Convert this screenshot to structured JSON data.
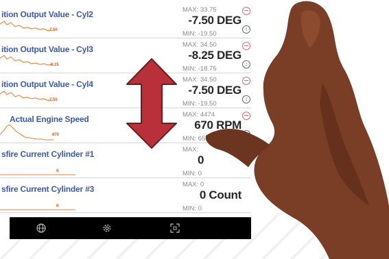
{
  "pids": [
    {
      "name": "ition Output Value - Cyl2",
      "max": "MAX: 33.75",
      "value": "-7.50 DEG",
      "min": "MIN: -19.50",
      "spark_label": "-7.50"
    },
    {
      "name": "ition Output Value - Cyl3",
      "max": "MAX: 34.50",
      "value": "-8.25 DEG",
      "min": "MIN: -18.75",
      "spark_label": "-8.25"
    },
    {
      "name": "ition Output Value - Cyl4",
      "max": "MAX: 34.50",
      "value": "-7.50 DEG",
      "min": "MIN: -19.50",
      "spark_label": "-7.50"
    },
    {
      "name": "Actual Engine Speed",
      "max": "MAX: 4474",
      "value": "670 RPM",
      "min": "MIN: 651",
      "spark_label": "670"
    },
    {
      "name": "sfire Current Cylinder #1",
      "max": "MAX:",
      "value": "0",
      "min": "MIN: 0",
      "spark_label": "0"
    },
    {
      "name": "sfire Current Cylinder #3",
      "max": "MAX: 0",
      "value": "0 Count",
      "min": "MIN: 0",
      "spark_label": "0"
    }
  ],
  "bottom_nav": {
    "icons": [
      "globe-icon",
      "gear-icon",
      "fullscreen-icon"
    ]
  },
  "colors": {
    "pid_name": "#3d5aa8",
    "sparkline": "#e8823c",
    "remove_button": "#e36b72",
    "scroll_arrow": "#b8313a",
    "nav_bar": "#000000"
  },
  "overlay": {
    "gesture_arrow": "vertical-double-arrow",
    "hand": "right-hand-swipe"
  }
}
